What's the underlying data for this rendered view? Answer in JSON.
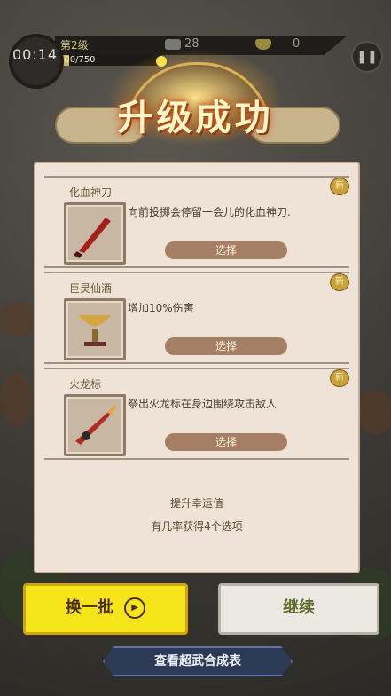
{
  "hud": {
    "timer": "00:14",
    "level": "第2级",
    "xp_text": "100/750",
    "xp_fraction": 0.133,
    "coins": "28",
    "ingots": "0"
  },
  "title": "升级成功",
  "cards": [
    {
      "name": "化血神刀",
      "desc": "向前投掷会停留一会儿的化血神刀.",
      "badge": "新",
      "button": "选择",
      "icon": "blood-blade-icon"
    },
    {
      "name": "巨灵仙酒",
      "desc": "增加10%伤害",
      "badge": "新",
      "button": "选择",
      "icon": "wine-goblet-icon"
    },
    {
      "name": "火龙标",
      "desc": "祭出火龙标在身边围绕攻击敌人",
      "badge": "新",
      "button": "选择",
      "icon": "fire-dragon-dart-icon"
    }
  ],
  "footer": {
    "line1": "提升幸运值",
    "line2": "有几率获得4个选项"
  },
  "buttons": {
    "swap": "换一批",
    "continue": "继续",
    "table": "查看超武合成表"
  },
  "colors": {
    "swap_button": "#f7e51c",
    "title_glow": "#c0561a",
    "select_button": "#a57f63"
  }
}
